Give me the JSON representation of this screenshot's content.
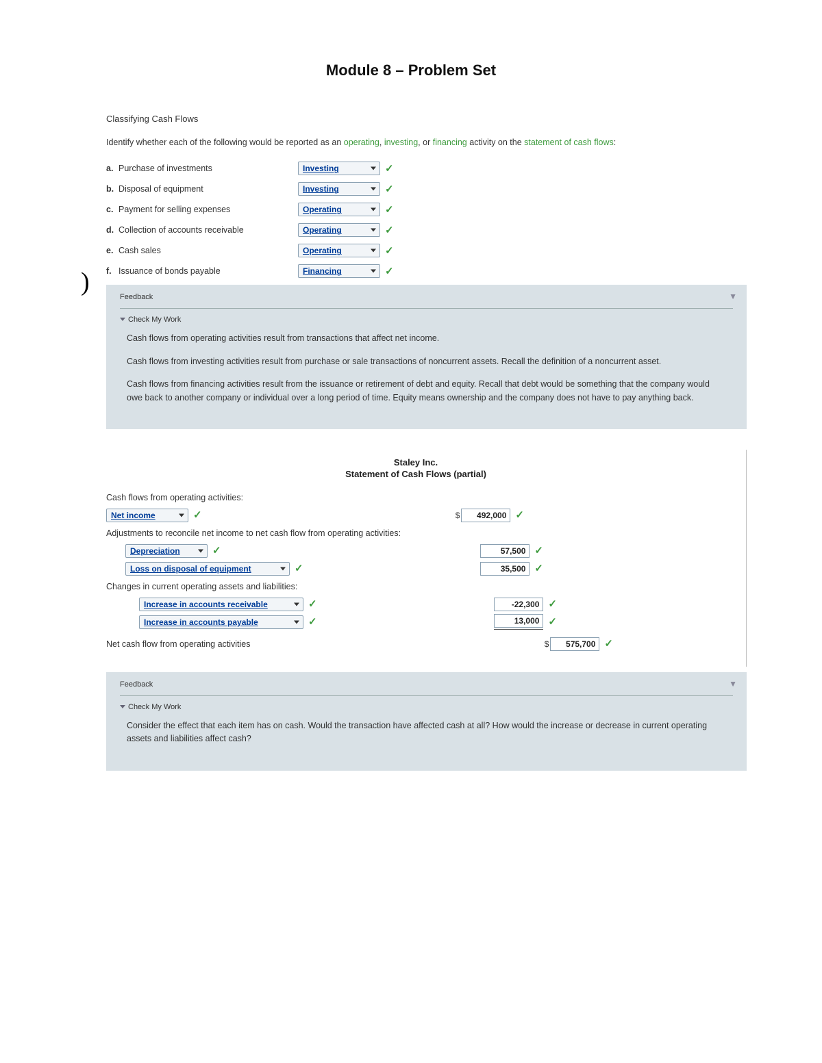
{
  "title": "Module 8 – Problem Set",
  "section1": {
    "heading": "Classifying Cash Flows",
    "prompt_pre": "Identify whether each of the following would be reported as an ",
    "kw_operating": "operating",
    "kw_investing": "investing",
    "sep_or": ", or ",
    "kw_financing": "financing",
    "prompt_mid": " activity on the ",
    "kw_stmt": "statement of cash flows",
    "colon": ":",
    "comma": ", "
  },
  "questions": [
    {
      "letter": "a.",
      "text": "Purchase of investments",
      "answer": "Investing"
    },
    {
      "letter": "b.",
      "text": "Disposal of equipment",
      "answer": "Investing"
    },
    {
      "letter": "c.",
      "text": "Payment for selling expenses",
      "answer": "Operating"
    },
    {
      "letter": "d.",
      "text": "Collection of accounts receivable",
      "answer": "Operating"
    },
    {
      "letter": "e.",
      "text": "Cash sales",
      "answer": "Operating"
    },
    {
      "letter": "f.",
      "text": "Issuance of bonds payable",
      "answer": "Financing"
    }
  ],
  "feedback1": {
    "heading": "Feedback",
    "cmw": "Check My Work",
    "p1": "Cash flows from operating activities result from transactions that affect net income.",
    "p2": "Cash flows from investing activities result from purchase or sale transactions of noncurrent assets. Recall the definition of a noncurrent asset.",
    "p3": "Cash flows from financing activities result from the issuance or retirement of debt and equity. Recall that debt would be something that the company would owe back to another company or individual over a long period of time. Equity means ownership and the company does not have to pay anything back."
  },
  "stmt": {
    "company": "Staley Inc.",
    "title": "Statement of Cash Flows (partial)",
    "line_oper_header": "Cash flows from operating activities:",
    "net_income_label": "Net income",
    "net_income_amt": "492,000",
    "adjustments_label": "Adjustments to reconcile net income to net cash flow from operating activities:",
    "dep_label": "Depreciation",
    "dep_amt": "57,500",
    "loss_label": "Loss on disposal of equipment",
    "loss_amt": "35,500",
    "changes_label": "Changes in current operating assets and liabilities:",
    "inc_ar_label": "Increase in accounts receivable",
    "inc_ar_amt": "-22,300",
    "inc_ap_label": "Increase in accounts payable",
    "inc_ap_amt": "13,000",
    "total_label": "Net cash flow from operating activities",
    "total_amt": "575,700"
  },
  "feedback2": {
    "heading": "Feedback",
    "cmw": "Check My Work",
    "p1": "Consider the effect that each item has on cash. Would the transaction have affected cash at all? How would the increase or decrease in current operating assets and liabilities affect cash?"
  },
  "paren": ")"
}
